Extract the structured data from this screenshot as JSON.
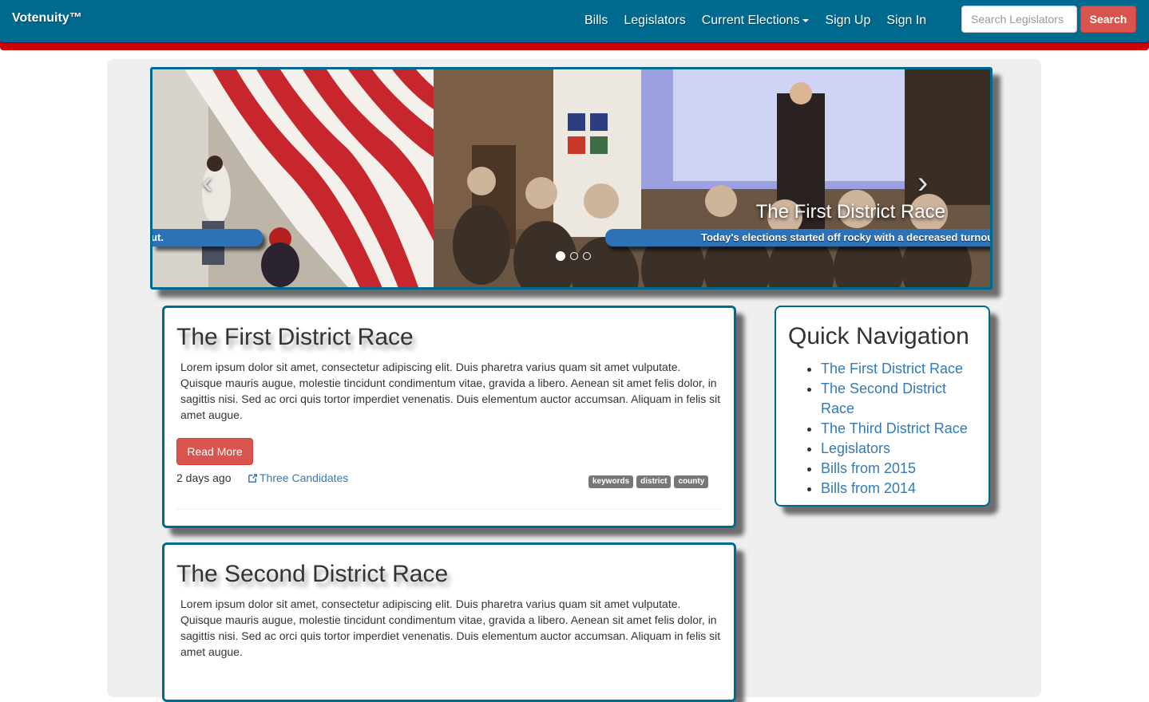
{
  "navbar": {
    "brand": "Votenuity™",
    "links": [
      "Bills",
      "Legislators",
      "Current Elections",
      "Sign Up",
      "Sign In"
    ],
    "search_placeholder": "Search Legislators",
    "search_button": "Search"
  },
  "carousel": {
    "caption_title": "The First District Race",
    "caption_text": "Today's elections started off rocky with a decreased turnout.",
    "caption_text_left": "ut.",
    "prev_icon": "chevron-left-icon",
    "next_icon": "chevron-right-icon",
    "indicators": 3,
    "active_indicator": 0
  },
  "articles": [
    {
      "title": "The First District Race",
      "body": "Lorem ipsum dolor sit amet, consectetur adipiscing elit. Duis pharetra varius quam sit amet vulputate. Quisque mauris augue, molestie tincidunt condimentum vitae, gravida a libero. Aenean sit amet felis dolor, in sagittis nisi. Sed ac orci quis tortor imperdiet venenatis. Duis elementum auctor accumsan. Aliquam in felis sit amet augue.",
      "read_more": "Read More",
      "time": "2 days ago",
      "link": "Three Candidates",
      "tags": [
        "keywords",
        "district",
        "county"
      ]
    },
    {
      "title": "The Second District Race",
      "body": "Lorem ipsum dolor sit amet, consectetur adipiscing elit. Duis pharetra varius quam sit amet vulputate. Quisque mauris augue, molestie tincidunt condimentum vitae, gravida a libero. Aenean sit amet felis dolor, in sagittis nisi. Sed ac orci quis tortor imperdiet venenatis. Duis elementum auctor accumsan. Aliquam in felis sit amet augue."
    }
  ],
  "quick_nav": {
    "title": "Quick Navigation",
    "items": [
      "The First District Race",
      "The Second District Race",
      "The Third District Race",
      "Legislators",
      "Bills from 2015",
      "Bills from 2014"
    ]
  },
  "colors": {
    "navbar": "#006a8e",
    "navbar_stripe": "#cc0000",
    "danger": "#d9534f",
    "link": "#337ab7",
    "tag": "#777777"
  }
}
